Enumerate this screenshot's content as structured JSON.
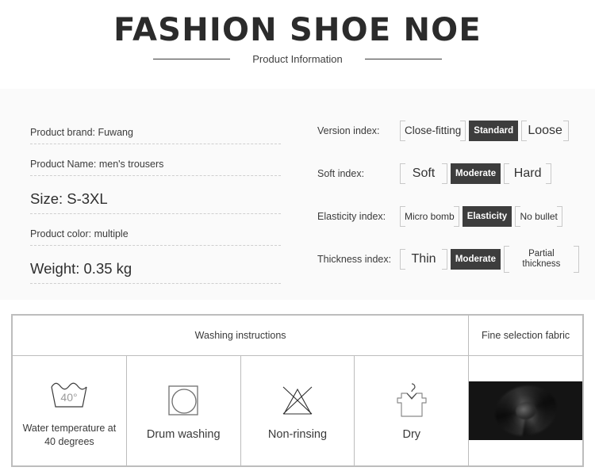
{
  "header": {
    "title": "FASHION SHOE NOE",
    "subtitle": "Product Information"
  },
  "specs": {
    "rows": [
      {
        "text": "Product brand: Fuwang",
        "size": "sm"
      },
      {
        "text": "Product Name: men's trousers",
        "size": "sm"
      },
      {
        "text": "Size: S-3XL",
        "size": "lg"
      },
      {
        "text": "Product color: multiple",
        "size": "sm"
      },
      {
        "text": "Weight: 0.35 kg",
        "size": "lg"
      }
    ]
  },
  "indices": {
    "rows": [
      {
        "label": "Version index:",
        "options": [
          {
            "label": "Close-fitting",
            "selected": false
          },
          {
            "label": "Standard",
            "selected": true
          },
          {
            "label": "Loose",
            "selected": false
          }
        ]
      },
      {
        "label": "Soft index:",
        "options": [
          {
            "label": "Soft",
            "selected": false
          },
          {
            "label": "Moderate",
            "selected": true
          },
          {
            "label": "Hard",
            "selected": false
          }
        ]
      },
      {
        "label": "Elasticity index:",
        "options": [
          {
            "label": "Micro bomb",
            "selected": false
          },
          {
            "label": "Elasticity",
            "selected": true
          },
          {
            "label": "No bullet",
            "selected": false
          }
        ]
      },
      {
        "label": "Thickness index:",
        "options": [
          {
            "label": "Thin",
            "selected": false
          },
          {
            "label": "Moderate",
            "selected": true
          },
          {
            "label": "Partial thickness",
            "selected": false
          }
        ]
      }
    ]
  },
  "care_table": {
    "header_washing": "Washing instructions",
    "header_fabric": "Fine selection fabric",
    "cells": [
      {
        "icon": "wash-tub-40-icon",
        "label": "Water temperature at 40 degrees",
        "icon_text": "40°"
      },
      {
        "icon": "drum-washing-icon",
        "label": "Drum washing"
      },
      {
        "icon": "no-rinsing-icon",
        "label": "Non-rinsing"
      },
      {
        "icon": "dry-hanger-icon",
        "label": "Dry"
      }
    ]
  },
  "colors": {
    "selected_chip_bg": "#3d3d3d",
    "panel_bg": "#fafafa",
    "table_border": "#bdbdbd",
    "fabric": "#1a1a1a"
  }
}
